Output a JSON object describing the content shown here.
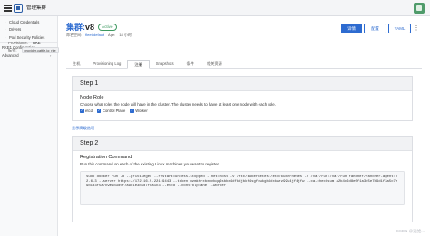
{
  "topbar": {
    "title": "管理集群"
  },
  "sidebar": {
    "items": [
      {
        "label": "Cloud Credentials",
        "kind": "child"
      },
      {
        "label": "Drivers",
        "kind": "child"
      },
      {
        "label": "Pod Security Policies",
        "kind": "child"
      },
      {
        "label": "RKE1 Configuration",
        "kind": "parent"
      },
      {
        "label": "Advanced",
        "kind": "parent"
      }
    ]
  },
  "header": {
    "cluster_name": "集群:",
    "cluster_suffix": "v8",
    "status": "Active",
    "namespace_label": "命名空间:",
    "namespace_value": "fleet-default",
    "age_label": "Age:",
    "age_value": "18 小时",
    "actions": {
      "primary": "详情",
      "config": "配置",
      "yaml": "YAML"
    }
  },
  "meta": {
    "provisioner_label": "Provisioner:",
    "provisioner_value": "RKE",
    "labels_label": "标签:",
    "labels_chip": "provider.cattle.io: rke"
  },
  "tabs": [
    "主机",
    "Provisioning Log",
    "注册",
    "Snapshots",
    "条件",
    "相关资源"
  ],
  "step1": {
    "title": "Step 1",
    "section_title": "Node Role",
    "description": "Choose what roles the node will have in the cluster. The cluster needs to have at least one node with each role.",
    "roles": [
      "etcd",
      "Control Plane",
      "Worker"
    ]
  },
  "advanced_link": "显示高级选项",
  "step2": {
    "title": "Step 2",
    "section_title": "Registration Command",
    "description": "Run this command on each of the existing Linux machines you want to register.",
    "command": "sudo docker run -d --privileged --restart=unless-stopped --net=host -v /etc/kubernetes:/etc/kubernetes -v /var/run:/var/run rancher/rancher-agent:v2.6.3 --server https://172.16.5.221:9443 --token mzmkfrxbxwvbqq6sbbx4dfkdjbkf4sgfxwkgb6dxkwrz99s4jf4jfw --ca-checksum a2b4c6d8e0f1a3c5e7b9d1f3a5c7e9b1d3f5a7c9e1b3d5f7a9c1e3b5d7f9a1c3 --etcd --controlplane --worker"
  },
  "watermark": "CSDN @运维..."
}
